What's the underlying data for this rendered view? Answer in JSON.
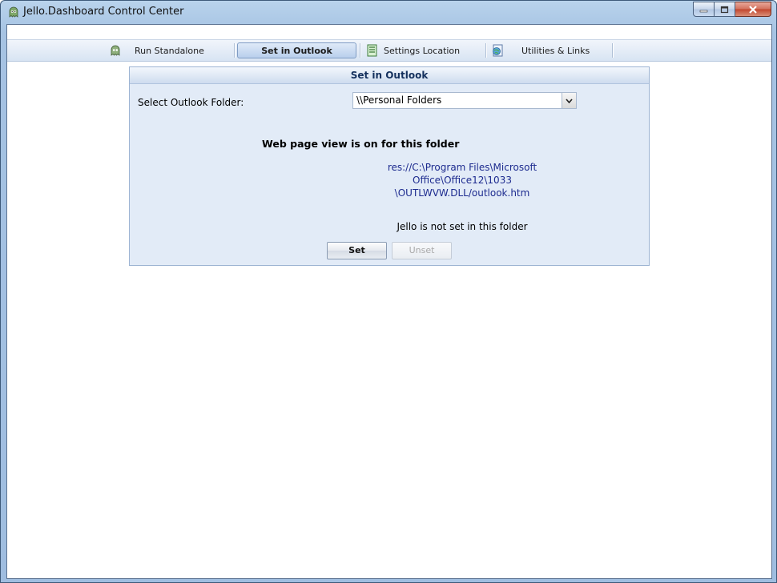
{
  "window": {
    "title": "Jello.Dashboard Control Center",
    "buttons": [
      "minimize",
      "maximize",
      "close"
    ]
  },
  "toolbar": {
    "tabs": [
      {
        "label": "Run Standalone",
        "icon": "ghost-icon"
      },
      {
        "label": "Set in Outlook",
        "active": true
      },
      {
        "label": "Settings Location",
        "icon": "list-icon"
      },
      {
        "label": "Utilities & Links",
        "icon": "globe-page-icon"
      }
    ]
  },
  "panel": {
    "header": "Set in Outlook",
    "folder_label": "Select Outlook Folder:",
    "folder_value": "\\\\Personal Folders",
    "status_heading": "Web page view is on for this folder",
    "path_lines": [
      "res://C:\\Program Files\\Microsoft",
      "Office\\Office12\\1033",
      "\\OUTLWVW.DLL/outlook.htm"
    ],
    "jello_status": "Jello is not set in this folder",
    "set_button": "Set",
    "unset_button": "Unset"
  },
  "colors": {
    "panel_bg": "#e2ebf7",
    "header_text": "#15315e",
    "path_text": "#1d2b8f"
  }
}
